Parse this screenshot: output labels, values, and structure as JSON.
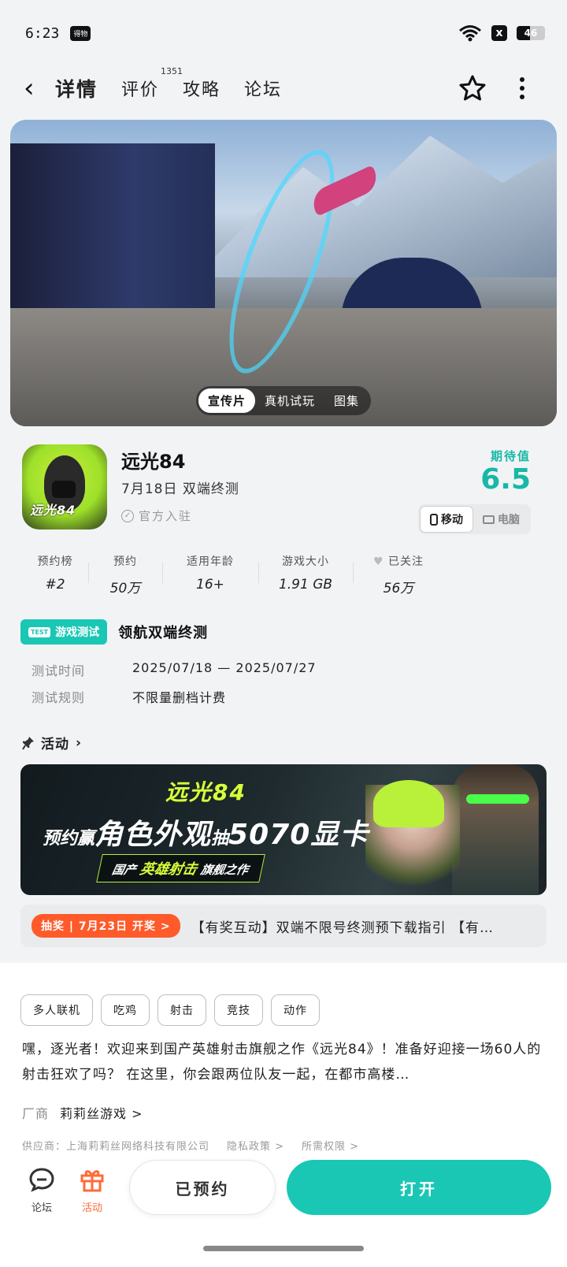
{
  "status_bar": {
    "time": "6:23",
    "app_badge": "得物",
    "x_badge": "x",
    "battery_level": 46,
    "battery_text": "46"
  },
  "nav": {
    "tabs": [
      {
        "label": "详情",
        "active": true
      },
      {
        "label": "评价",
        "count": "1351"
      },
      {
        "label": "攻略"
      },
      {
        "label": "论坛"
      }
    ],
    "icons": [
      "back-arrow-icon",
      "star-icon",
      "more-vert-icon"
    ]
  },
  "media": {
    "tabs": [
      "宣传片",
      "真机试玩",
      "图集"
    ]
  },
  "app": {
    "icon_text": "远光84",
    "name": "远光84",
    "subtitle": "7月18日 双端终测",
    "official": "官方入驻",
    "rating_label": "期待值",
    "rating_value": "6.5",
    "platforms": [
      "移动",
      "电脑"
    ]
  },
  "stats": [
    {
      "label": "预约榜",
      "value": "#2"
    },
    {
      "label": "预约",
      "value": "50万"
    },
    {
      "label": "适用年龄",
      "value": "16+"
    },
    {
      "label": "游戏大小",
      "value": "1.91 GB"
    },
    {
      "label": "已关注",
      "value": "56万"
    }
  ],
  "test": {
    "badge": "游戏测试",
    "badge_tag": "TEST",
    "title": "领航双端终测",
    "time_label": "测试时间",
    "time_value": "2025/07/18 — 2025/07/27",
    "rule_label": "测试规则",
    "rule_value": "不限量删档计费"
  },
  "activity": {
    "heading": "活动",
    "banner": {
      "logo": "远光84",
      "small1": "预约赢",
      "large1": "角色外观",
      "small2": "抽",
      "large2": "5070显卡",
      "sub_a": "国产",
      "sub_hl": "英雄射击",
      "sub_b": "旗舰之作"
    },
    "lottery": "抽奖 | 7月23日 开奖 >",
    "notice": "【有奖互动】双端不限号终测预下载指引 【有…"
  },
  "tags": [
    "多人联机",
    "吃鸡",
    "射击",
    "竞技",
    "动作"
  ],
  "description": "嘿，逐光者！欢迎来到国产英雄射击旗舰之作《远光84》！准备好迎接一场60人的射击狂欢了吗？ 在这里，你会跟两位队友一起，在都市高楼…",
  "vendor": {
    "label": "厂商",
    "name": "莉莉丝游戏 >"
  },
  "supplier": {
    "text": "供应商：上海莉莉丝网络科技有限公司",
    "privacy": "隐私政策 >",
    "permissions": "所需权限 >"
  },
  "bottom_bar": {
    "forum": "论坛",
    "activity": "活动",
    "reserved": "已预约",
    "open": "打开"
  },
  "colors": {
    "accent": "#19c7b4",
    "orange": "#ff5a2a",
    "activity_label": "#ff6a3a"
  }
}
